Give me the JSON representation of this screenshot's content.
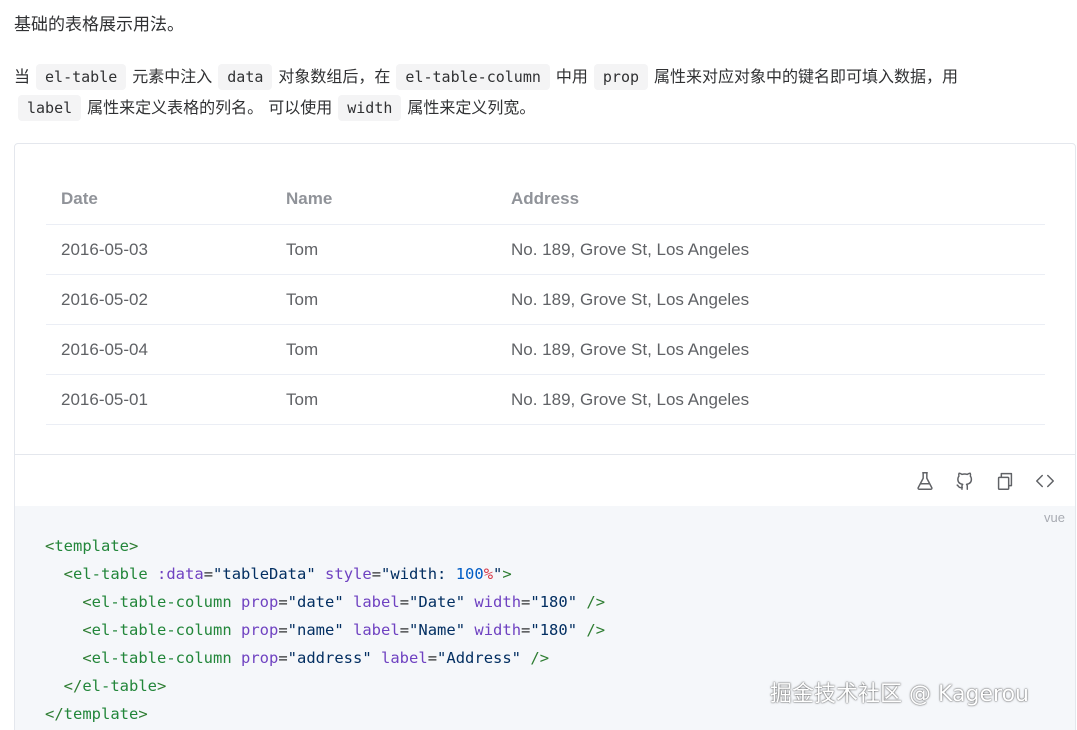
{
  "intro": "基础的表格展示用法。",
  "description": {
    "line1": [
      {
        "t": "text",
        "v": "当"
      },
      {
        "t": "code",
        "v": "el-table"
      },
      {
        "t": "text",
        "v": "元素中注入"
      },
      {
        "t": "code",
        "v": "data"
      },
      {
        "t": "text",
        "v": "对象数组后，在"
      },
      {
        "t": "code",
        "v": "el-table-column"
      },
      {
        "t": "text",
        "v": "中用"
      },
      {
        "t": "code",
        "v": "prop"
      },
      {
        "t": "text",
        "v": "属性来对应对象中的键名即可填入数据，用"
      }
    ],
    "line2": [
      {
        "t": "code",
        "v": "label"
      },
      {
        "t": "text",
        "v": "属性来定义表格的列名。 可以使用"
      },
      {
        "t": "code",
        "v": "width"
      },
      {
        "t": "text",
        "v": "属性来定义列宽。"
      }
    ]
  },
  "table": {
    "columns": [
      "Date",
      "Name",
      "Address"
    ],
    "rows": [
      [
        "2016-05-03",
        "Tom",
        "No. 189, Grove St, Los Angeles"
      ],
      [
        "2016-05-02",
        "Tom",
        "No. 189, Grove St, Los Angeles"
      ],
      [
        "2016-05-04",
        "Tom",
        "No. 189, Grove St, Los Angeles"
      ],
      [
        "2016-05-01",
        "Tom",
        "No. 189, Grove St, Los Angeles"
      ]
    ]
  },
  "toolbar": {
    "icons": [
      "playground-icon",
      "github-icon",
      "copy-icon",
      "view-source-icon"
    ]
  },
  "code": {
    "language": "vue",
    "lines": [
      [
        [
          "tg",
          "<"
        ],
        [
          "tg-name",
          "template"
        ],
        [
          "tg",
          ">"
        ]
      ],
      [
        [
          "pu",
          "  "
        ],
        [
          "tg",
          "<"
        ],
        [
          "tg-name",
          "el-table"
        ],
        [
          "pu",
          " "
        ],
        [
          "at",
          ":data"
        ],
        [
          "pu",
          "="
        ],
        [
          "st",
          "\"tableData\""
        ],
        [
          "pu",
          " "
        ],
        [
          "at",
          "style"
        ],
        [
          "pu",
          "="
        ],
        [
          "st",
          "\"width: "
        ],
        [
          "kw",
          "100"
        ],
        [
          "pct",
          "%"
        ],
        [
          "st",
          "\""
        ],
        [
          "tg",
          ">"
        ]
      ],
      [
        [
          "pu",
          "    "
        ],
        [
          "tg",
          "<"
        ],
        [
          "tg-name",
          "el-table-column"
        ],
        [
          "pu",
          " "
        ],
        [
          "at",
          "prop"
        ],
        [
          "pu",
          "="
        ],
        [
          "st",
          "\"date\""
        ],
        [
          "pu",
          " "
        ],
        [
          "at",
          "label"
        ],
        [
          "pu",
          "="
        ],
        [
          "st",
          "\"Date\""
        ],
        [
          "pu",
          " "
        ],
        [
          "at",
          "width"
        ],
        [
          "pu",
          "="
        ],
        [
          "st",
          "\"180\""
        ],
        [
          "pu",
          " "
        ],
        [
          "tg",
          "/>"
        ]
      ],
      [
        [
          "pu",
          "    "
        ],
        [
          "tg",
          "<"
        ],
        [
          "tg-name",
          "el-table-column"
        ],
        [
          "pu",
          " "
        ],
        [
          "at",
          "prop"
        ],
        [
          "pu",
          "="
        ],
        [
          "st",
          "\"name\""
        ],
        [
          "pu",
          " "
        ],
        [
          "at",
          "label"
        ],
        [
          "pu",
          "="
        ],
        [
          "st",
          "\"Name\""
        ],
        [
          "pu",
          " "
        ],
        [
          "at",
          "width"
        ],
        [
          "pu",
          "="
        ],
        [
          "st",
          "\"180\""
        ],
        [
          "pu",
          " "
        ],
        [
          "tg",
          "/>"
        ]
      ],
      [
        [
          "pu",
          "    "
        ],
        [
          "tg",
          "<"
        ],
        [
          "tg-name",
          "el-table-column"
        ],
        [
          "pu",
          " "
        ],
        [
          "at",
          "prop"
        ],
        [
          "pu",
          "="
        ],
        [
          "st",
          "\"address\""
        ],
        [
          "pu",
          " "
        ],
        [
          "at",
          "label"
        ],
        [
          "pu",
          "="
        ],
        [
          "st",
          "\"Address\""
        ],
        [
          "pu",
          " "
        ],
        [
          "tg",
          "/>"
        ]
      ],
      [
        [
          "pu",
          "  "
        ],
        [
          "tg",
          "</"
        ],
        [
          "tg-name",
          "el-table"
        ],
        [
          "tg",
          ">"
        ]
      ],
      [
        [
          "tg",
          "</"
        ],
        [
          "tg-name",
          "template"
        ],
        [
          "tg",
          ">"
        ]
      ]
    ]
  },
  "watermark": "掘金技术社区 @ Kagerou"
}
